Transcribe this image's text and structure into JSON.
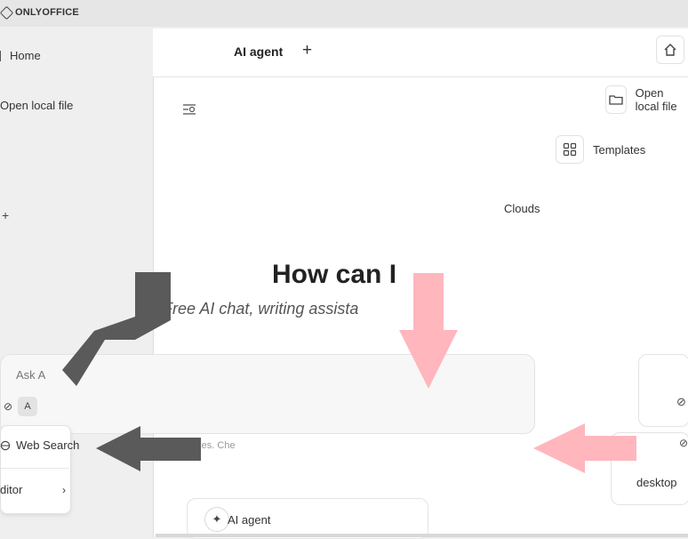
{
  "brand": {
    "name": "ONLYOFFICE"
  },
  "sidebar": {
    "items": [
      {
        "label": "Home",
        "icon": "home-icon"
      },
      {
        "label": "Open local file",
        "icon": "folder-icon"
      }
    ]
  },
  "tab": {
    "title": "AI agent",
    "add": "+"
  },
  "quick_actions": {
    "home_icon": "home-icon",
    "open_label": "Open local file",
    "templates_label": "Templates",
    "clouds_label": "Clouds"
  },
  "hero": {
    "title": "How can I",
    "subtitle": "Free AI chat, writing assista"
  },
  "chat": {
    "placeholder": "Ask A",
    "chip_label": "A"
  },
  "dropdown": {
    "web_search": "Web Search",
    "editor": "ditor",
    "chevron": "›"
  },
  "hint": {
    "text": "takes. Che"
  },
  "desktop": {
    "label": "desktop"
  },
  "agent": {
    "label": "AI agent"
  },
  "colors": {
    "arrow_dark": "#5a5a5a",
    "arrow_pink": "#ffb6bd",
    "panel_bg": "#ffffff",
    "sidebar_bg": "#efefef"
  }
}
